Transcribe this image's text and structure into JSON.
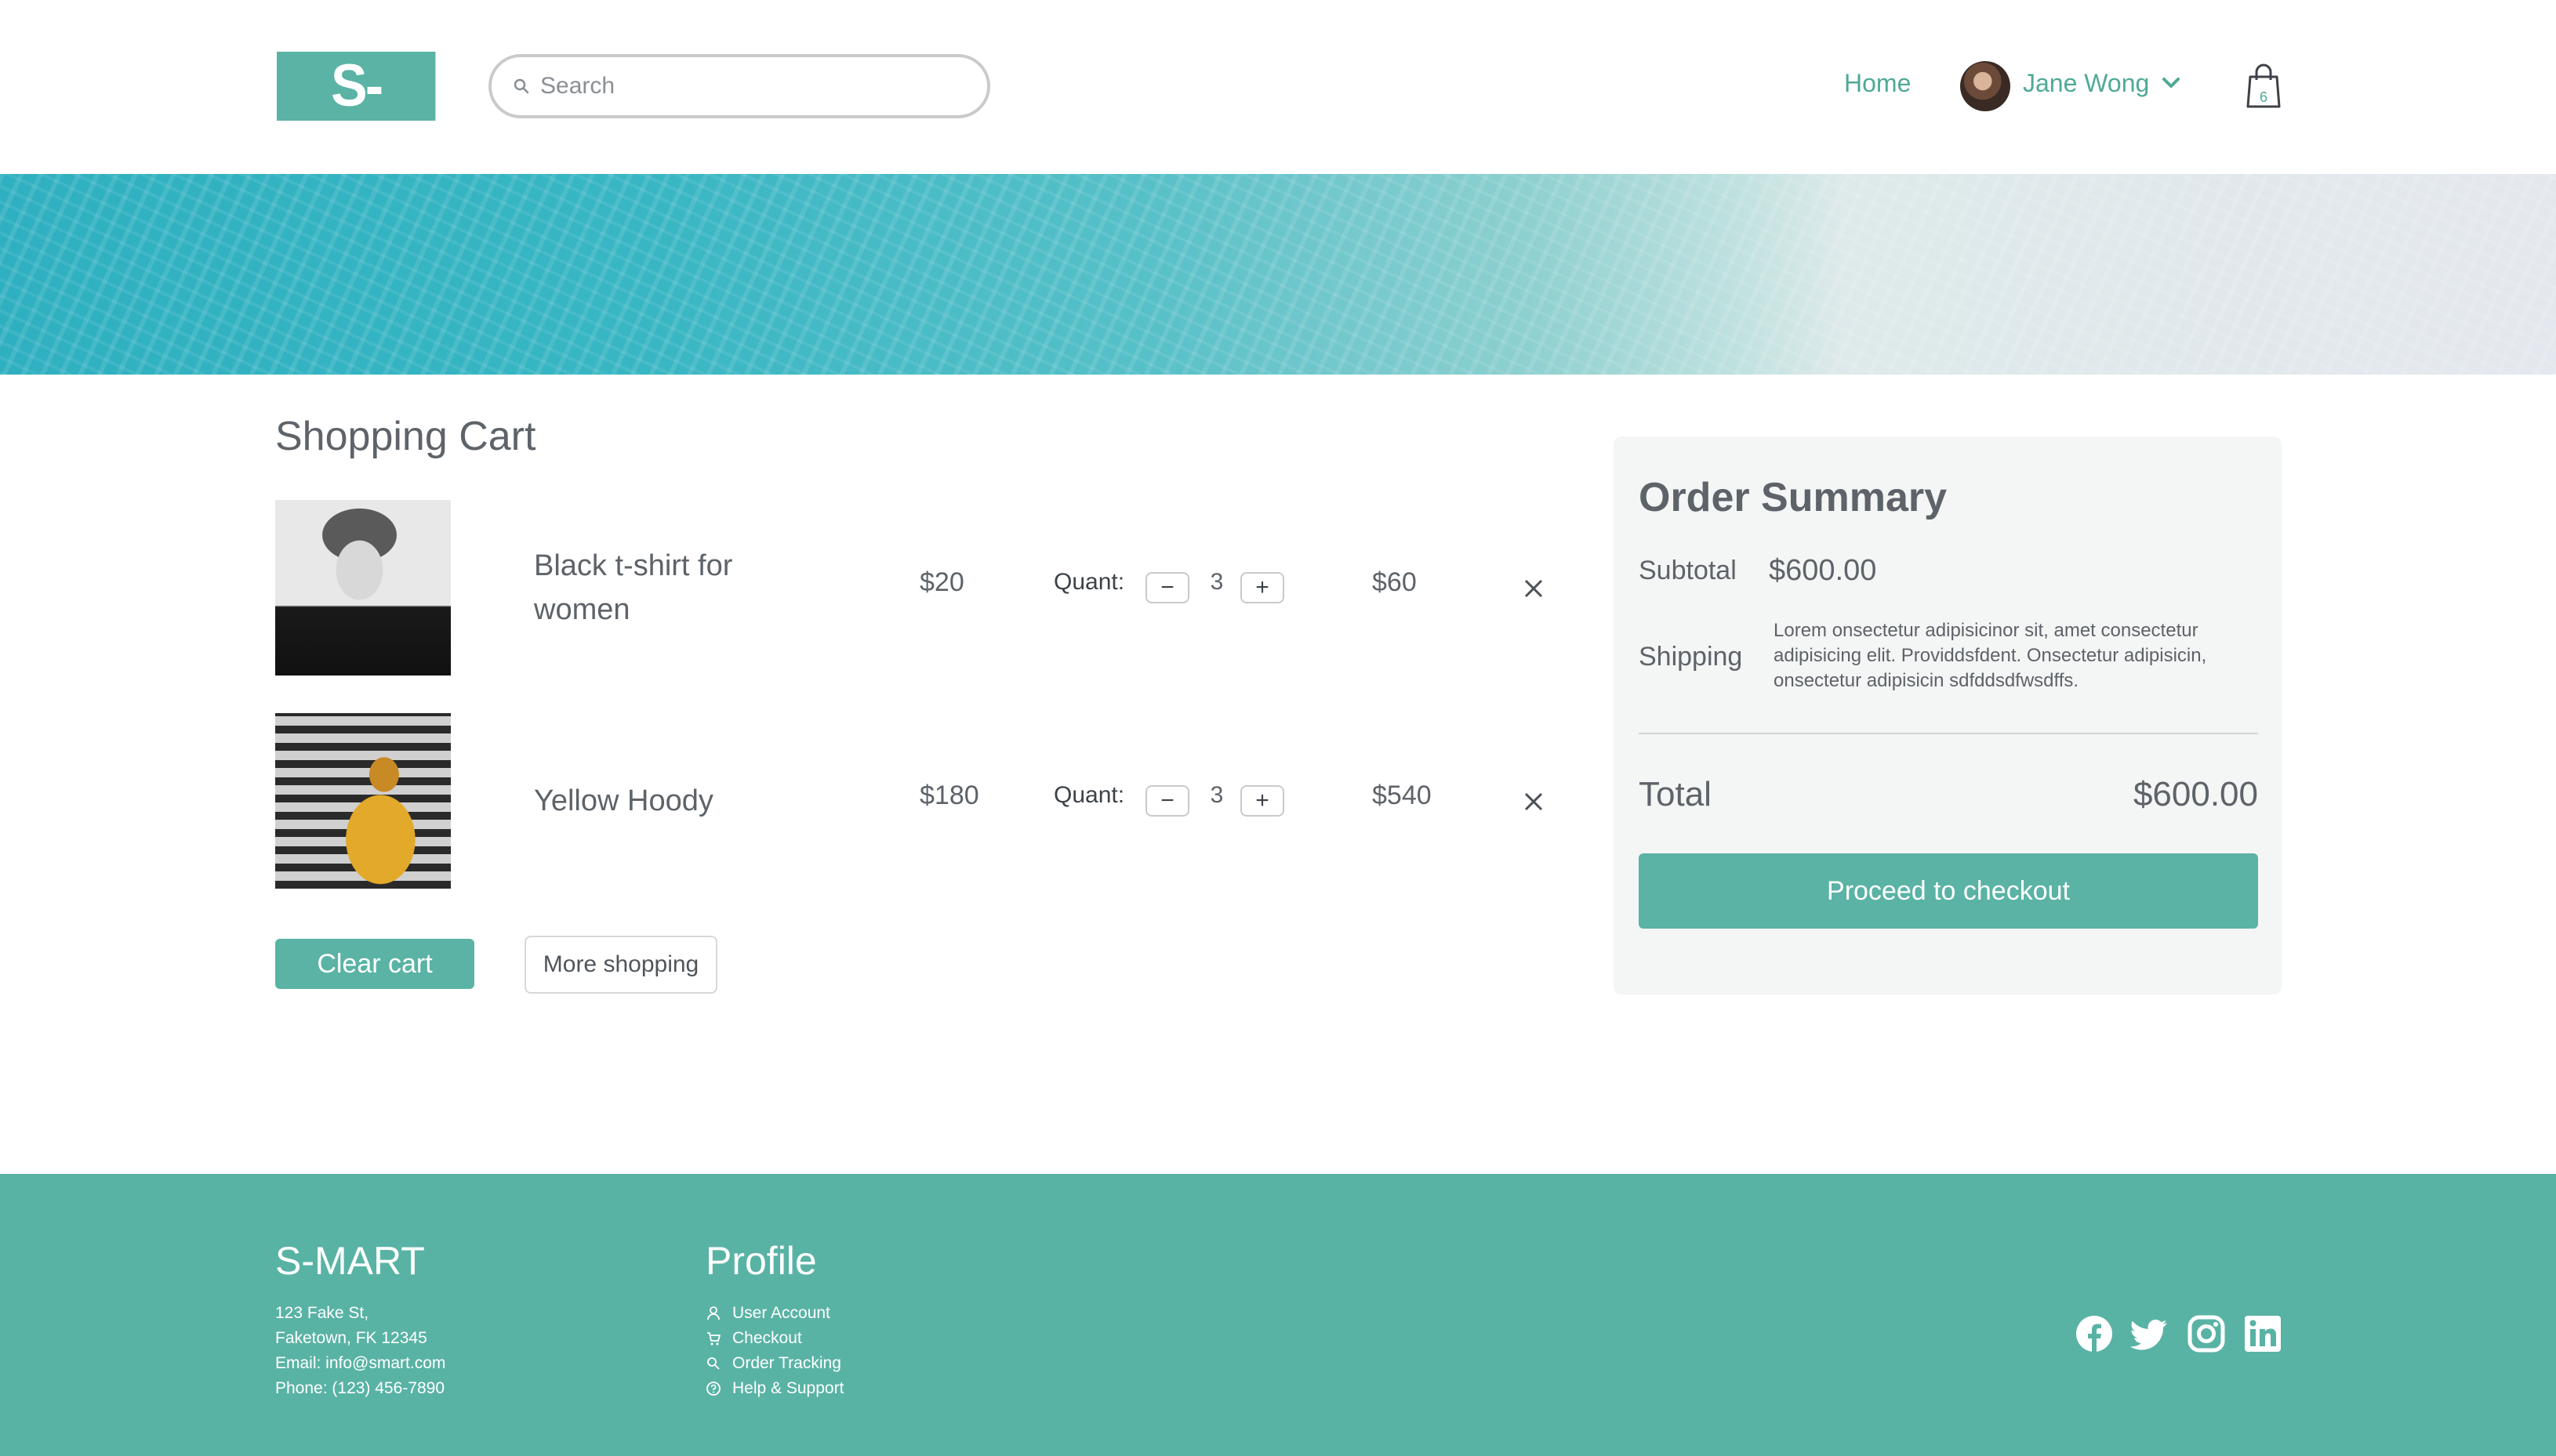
{
  "header": {
    "logo": "S-MART",
    "search_placeholder": "Search",
    "nav_home": "Home",
    "user_name": "Jane Wong",
    "cart_count": "6"
  },
  "cart": {
    "title": "Shopping Cart",
    "items": [
      {
        "name": "Black t-shirt for women",
        "price": "$20",
        "quant_label": "Quant:",
        "qty": "3",
        "total": "$60"
      },
      {
        "name": "Yellow Hoody",
        "price": "$180",
        "quant_label": "Quant:",
        "qty": "3",
        "total": "$540"
      }
    ],
    "minus_label": "−",
    "plus_label": "+",
    "clear_label": "Clear cart",
    "more_label": "More shopping"
  },
  "summary": {
    "title": "Order Summary",
    "subtotal_label": "Subtotal",
    "subtotal_value": "$600.00",
    "shipping_label": "Shipping",
    "shipping_text": "Lorem onsectetur adipisicinor sit, amet consectetur adipisicing elit. Providdsfdent. Onsectetur adipisicin, onsectetur adipisicin sdfddsdfwsdffs.",
    "total_label": "Total",
    "total_value": "$600.00",
    "checkout_label": "Proceed to checkout"
  },
  "footer": {
    "brand": "S-MART",
    "address_line1": "123 Fake St,",
    "address_line2": "Faketown, FK 12345",
    "email": "Email: info@smart.com",
    "phone": "Phone: (123) 456-7890",
    "profile_title": "Profile",
    "links": [
      "User Account",
      "Checkout",
      "Order Tracking",
      "Help & Support"
    ]
  },
  "colors": {
    "accent": "#5ab3a4",
    "text": "#5d6369",
    "summary_bg": "#f4f5f5"
  },
  "icons": [
    "search-icon",
    "chevron-down-icon",
    "shopping-bag-icon",
    "close-icon",
    "user-icon",
    "cart-icon",
    "search-icon",
    "help-icon",
    "facebook-icon",
    "twitter-icon",
    "instagram-icon",
    "linkedin-icon"
  ]
}
